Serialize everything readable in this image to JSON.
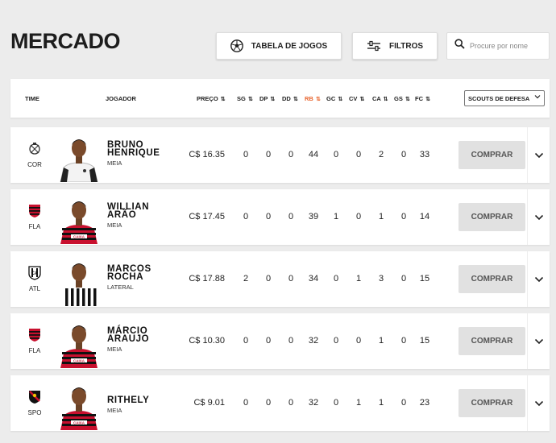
{
  "title": "MERCADO",
  "toolbar": {
    "tabela_label": "TABELA DE JOGOS",
    "filtros_label": "FILTROS",
    "search_placeholder": "Procure por nome"
  },
  "columns": {
    "time": "TIME",
    "jogador": "JOGADOR",
    "preco": "PREÇO",
    "stats": [
      "SG",
      "DP",
      "DD",
      "RB",
      "GC",
      "CV",
      "CA",
      "GS",
      "FC"
    ],
    "active_stat": "RB",
    "sort_glyph": "⇅",
    "scouts_select": "SCOUTS DE DEFESA"
  },
  "currency": "C$",
  "buy_label": "COMPRAR",
  "colors": {
    "accent": "#e8632c",
    "buy_bg": "#e1e1e1"
  },
  "players": [
    {
      "team": "COR",
      "team_icon": "corinthians-crest-icon",
      "name_lines": [
        "BRUNO",
        "HENRIQUE"
      ],
      "position": "MEIA",
      "price": "16.35",
      "stats": [
        "0",
        "0",
        "0",
        "44",
        "0",
        "0",
        "2",
        "0",
        "33"
      ],
      "shirt": "white"
    },
    {
      "team": "FLA",
      "team_icon": "flamengo-crest-icon",
      "name_lines": [
        "WILLIAN",
        "ARÃO"
      ],
      "position": "MEIA",
      "price": "17.45",
      "stats": [
        "0",
        "0",
        "0",
        "39",
        "1",
        "0",
        "1",
        "0",
        "14"
      ],
      "shirt": "redblack"
    },
    {
      "team": "ATL",
      "team_icon": "atletico-crest-icon",
      "name_lines": [
        "MARCOS",
        "ROCHA"
      ],
      "position": "LATERAL",
      "price": "17.88",
      "stats": [
        "2",
        "0",
        "0",
        "34",
        "0",
        "1",
        "3",
        "0",
        "15"
      ],
      "shirt": "stripes"
    },
    {
      "team": "FLA",
      "team_icon": "flamengo-crest-icon",
      "name_lines": [
        "MÁRCIO",
        "ARAUJO"
      ],
      "position": "MEIA",
      "price": "10.30",
      "stats": [
        "0",
        "0",
        "0",
        "32",
        "0",
        "0",
        "1",
        "0",
        "15"
      ],
      "shirt": "redblack"
    },
    {
      "team": "SPO",
      "team_icon": "sport-crest-icon",
      "name_lines": [
        "RITHELY"
      ],
      "position": "MEIA",
      "price": "9.01",
      "stats": [
        "0",
        "0",
        "0",
        "32",
        "0",
        "1",
        "1",
        "0",
        "23"
      ],
      "shirt": "redblack"
    }
  ]
}
